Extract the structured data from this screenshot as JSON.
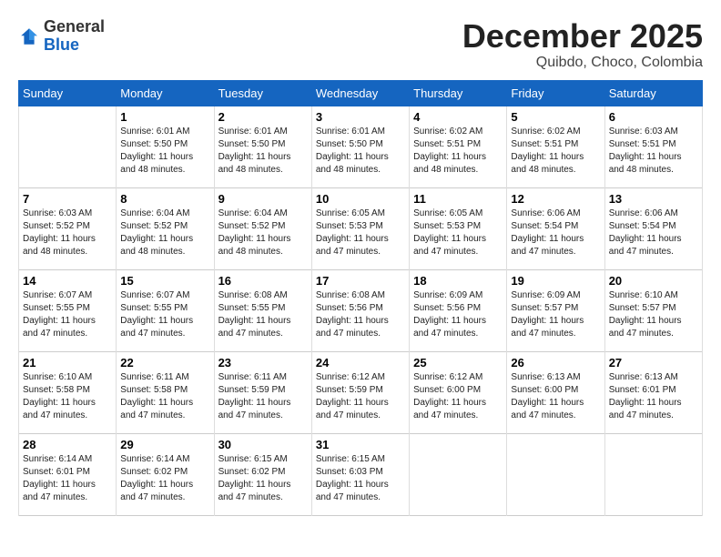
{
  "header": {
    "logo_general": "General",
    "logo_blue": "Blue",
    "month_year": "December 2025",
    "location": "Quibdo, Choco, Colombia"
  },
  "days_of_week": [
    "Sunday",
    "Monday",
    "Tuesday",
    "Wednesday",
    "Thursday",
    "Friday",
    "Saturday"
  ],
  "weeks": [
    [
      {
        "day": "",
        "info": ""
      },
      {
        "day": "1",
        "info": "Sunrise: 6:01 AM\nSunset: 5:50 PM\nDaylight: 11 hours\nand 48 minutes."
      },
      {
        "day": "2",
        "info": "Sunrise: 6:01 AM\nSunset: 5:50 PM\nDaylight: 11 hours\nand 48 minutes."
      },
      {
        "day": "3",
        "info": "Sunrise: 6:01 AM\nSunset: 5:50 PM\nDaylight: 11 hours\nand 48 minutes."
      },
      {
        "day": "4",
        "info": "Sunrise: 6:02 AM\nSunset: 5:51 PM\nDaylight: 11 hours\nand 48 minutes."
      },
      {
        "day": "5",
        "info": "Sunrise: 6:02 AM\nSunset: 5:51 PM\nDaylight: 11 hours\nand 48 minutes."
      },
      {
        "day": "6",
        "info": "Sunrise: 6:03 AM\nSunset: 5:51 PM\nDaylight: 11 hours\nand 48 minutes."
      }
    ],
    [
      {
        "day": "7",
        "info": "Sunrise: 6:03 AM\nSunset: 5:52 PM\nDaylight: 11 hours\nand 48 minutes."
      },
      {
        "day": "8",
        "info": "Sunrise: 6:04 AM\nSunset: 5:52 PM\nDaylight: 11 hours\nand 48 minutes."
      },
      {
        "day": "9",
        "info": "Sunrise: 6:04 AM\nSunset: 5:52 PM\nDaylight: 11 hours\nand 48 minutes."
      },
      {
        "day": "10",
        "info": "Sunrise: 6:05 AM\nSunset: 5:53 PM\nDaylight: 11 hours\nand 47 minutes."
      },
      {
        "day": "11",
        "info": "Sunrise: 6:05 AM\nSunset: 5:53 PM\nDaylight: 11 hours\nand 47 minutes."
      },
      {
        "day": "12",
        "info": "Sunrise: 6:06 AM\nSunset: 5:54 PM\nDaylight: 11 hours\nand 47 minutes."
      },
      {
        "day": "13",
        "info": "Sunrise: 6:06 AM\nSunset: 5:54 PM\nDaylight: 11 hours\nand 47 minutes."
      }
    ],
    [
      {
        "day": "14",
        "info": "Sunrise: 6:07 AM\nSunset: 5:55 PM\nDaylight: 11 hours\nand 47 minutes."
      },
      {
        "day": "15",
        "info": "Sunrise: 6:07 AM\nSunset: 5:55 PM\nDaylight: 11 hours\nand 47 minutes."
      },
      {
        "day": "16",
        "info": "Sunrise: 6:08 AM\nSunset: 5:55 PM\nDaylight: 11 hours\nand 47 minutes."
      },
      {
        "day": "17",
        "info": "Sunrise: 6:08 AM\nSunset: 5:56 PM\nDaylight: 11 hours\nand 47 minutes."
      },
      {
        "day": "18",
        "info": "Sunrise: 6:09 AM\nSunset: 5:56 PM\nDaylight: 11 hours\nand 47 minutes."
      },
      {
        "day": "19",
        "info": "Sunrise: 6:09 AM\nSunset: 5:57 PM\nDaylight: 11 hours\nand 47 minutes."
      },
      {
        "day": "20",
        "info": "Sunrise: 6:10 AM\nSunset: 5:57 PM\nDaylight: 11 hours\nand 47 minutes."
      }
    ],
    [
      {
        "day": "21",
        "info": "Sunrise: 6:10 AM\nSunset: 5:58 PM\nDaylight: 11 hours\nand 47 minutes."
      },
      {
        "day": "22",
        "info": "Sunrise: 6:11 AM\nSunset: 5:58 PM\nDaylight: 11 hours\nand 47 minutes."
      },
      {
        "day": "23",
        "info": "Sunrise: 6:11 AM\nSunset: 5:59 PM\nDaylight: 11 hours\nand 47 minutes."
      },
      {
        "day": "24",
        "info": "Sunrise: 6:12 AM\nSunset: 5:59 PM\nDaylight: 11 hours\nand 47 minutes."
      },
      {
        "day": "25",
        "info": "Sunrise: 6:12 AM\nSunset: 6:00 PM\nDaylight: 11 hours\nand 47 minutes."
      },
      {
        "day": "26",
        "info": "Sunrise: 6:13 AM\nSunset: 6:00 PM\nDaylight: 11 hours\nand 47 minutes."
      },
      {
        "day": "27",
        "info": "Sunrise: 6:13 AM\nSunset: 6:01 PM\nDaylight: 11 hours\nand 47 minutes."
      }
    ],
    [
      {
        "day": "28",
        "info": "Sunrise: 6:14 AM\nSunset: 6:01 PM\nDaylight: 11 hours\nand 47 minutes."
      },
      {
        "day": "29",
        "info": "Sunrise: 6:14 AM\nSunset: 6:02 PM\nDaylight: 11 hours\nand 47 minutes."
      },
      {
        "day": "30",
        "info": "Sunrise: 6:15 AM\nSunset: 6:02 PM\nDaylight: 11 hours\nand 47 minutes."
      },
      {
        "day": "31",
        "info": "Sunrise: 6:15 AM\nSunset: 6:03 PM\nDaylight: 11 hours\nand 47 minutes."
      },
      {
        "day": "",
        "info": ""
      },
      {
        "day": "",
        "info": ""
      },
      {
        "day": "",
        "info": ""
      }
    ]
  ]
}
